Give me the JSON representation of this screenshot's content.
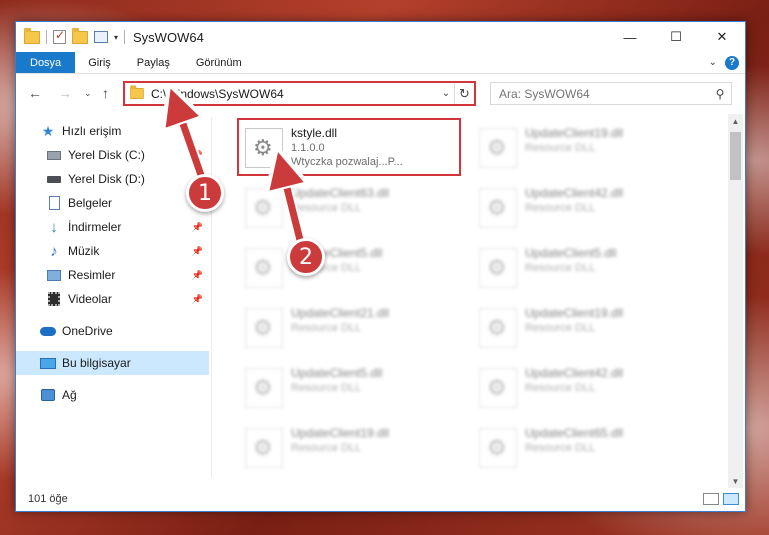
{
  "window": {
    "title": "SysWOW64"
  },
  "ribbon": {
    "tabs": [
      {
        "label": "Dosya"
      },
      {
        "label": "Giriş"
      },
      {
        "label": "Paylaş"
      },
      {
        "label": "Görünüm"
      }
    ],
    "help_label": "?"
  },
  "address": {
    "path": "C:\\Windows\\SysWOW64"
  },
  "search": {
    "placeholder": "Ara: SysWOW64"
  },
  "sidebar": {
    "items": [
      {
        "label": "Hızlı erişim",
        "icon": "star-icon"
      },
      {
        "label": "Yerel Disk (C:)",
        "icon": "disk-icon"
      },
      {
        "label": "Yerel Disk (D:)",
        "icon": "disk-icon"
      },
      {
        "label": "Belgeler",
        "icon": "documents-icon"
      },
      {
        "label": "İndirmeler",
        "icon": "download-icon"
      },
      {
        "label": "Müzik",
        "icon": "music-icon"
      },
      {
        "label": "Resimler",
        "icon": "pictures-icon"
      },
      {
        "label": "Videolar",
        "icon": "videos-icon"
      },
      {
        "label": "OneDrive",
        "icon": "cloud-icon"
      },
      {
        "label": "Bu bilgisayar",
        "icon": "computer-icon"
      },
      {
        "label": "Ağ",
        "icon": "network-icon"
      }
    ]
  },
  "files": [
    {
      "name": "kstyle.dll",
      "version": "1.1.0.0",
      "desc": "Wtyczka pozwalaj...P..."
    },
    {
      "name": "UpdateClient19.dll",
      "desc": "Resource DLL"
    },
    {
      "name": "UpdateClient63.dll",
      "desc": "Resource DLL"
    },
    {
      "name": "UpdateClient42.dll",
      "desc": "Resource DLL"
    },
    {
      "name": "UpdateClient5.dll",
      "desc": "Resource DLL"
    },
    {
      "name": "UpdateClient5.dll",
      "desc": "Resource DLL"
    },
    {
      "name": "UpdateClient21.dll",
      "desc": "Resource DLL"
    },
    {
      "name": "UpdateClient19.dll",
      "desc": "Resource DLL"
    },
    {
      "name": "UpdateClient5.dll",
      "desc": "Resource DLL"
    },
    {
      "name": "UpdateClient42.dll",
      "desc": "Resource DLL"
    },
    {
      "name": "UpdateClient19.dll",
      "desc": "Resource DLL"
    },
    {
      "name": "UpdateClient65.dll",
      "desc": "Resource DLL"
    }
  ],
  "status": {
    "count": "101 öğe"
  },
  "annotations": {
    "step1": "1",
    "step2": "2",
    "color": "#cc3b3b"
  }
}
